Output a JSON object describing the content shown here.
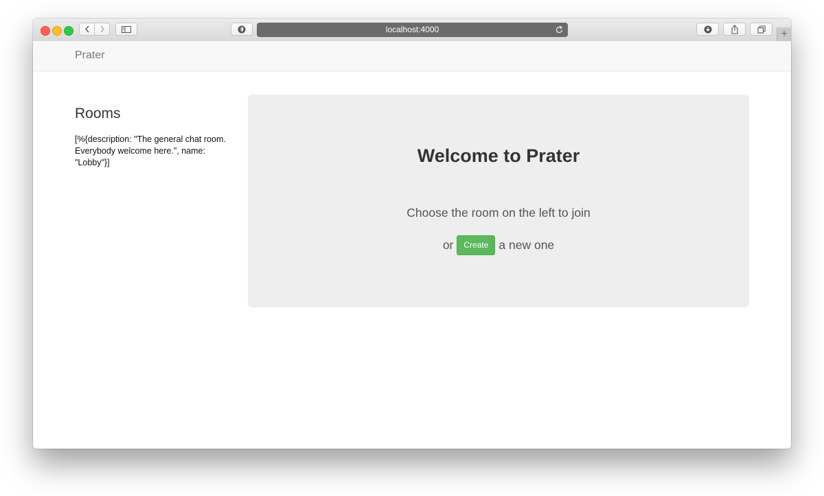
{
  "browser": {
    "address": "localhost:4000",
    "new_tab_symbol": "+",
    "icons": {
      "back": "chevron-left-icon",
      "forward": "chevron-right-icon",
      "sidebar": "sidebar-icon",
      "privacy": "shield-icon",
      "reload": "reload-icon",
      "download": "download-icon",
      "share": "share-icon",
      "tabs": "tabs-icon"
    }
  },
  "navbar": {
    "brand": "Prater"
  },
  "sidebar": {
    "title": "Rooms",
    "rooms_text": "[%{description: \"The general chat room. Everybody welcome here.\", name: \"Lobby\"}]"
  },
  "jumbotron": {
    "title": "Welcome to Prater",
    "subtitle": "Choose the room on the left to join",
    "or_label": "or",
    "create_button": "Create",
    "after_label": "a new one"
  },
  "colors": {
    "create_button": "#5cb85c",
    "jumbotron_bg": "#eeeeee",
    "navbar_bg": "#f8f8f8"
  }
}
